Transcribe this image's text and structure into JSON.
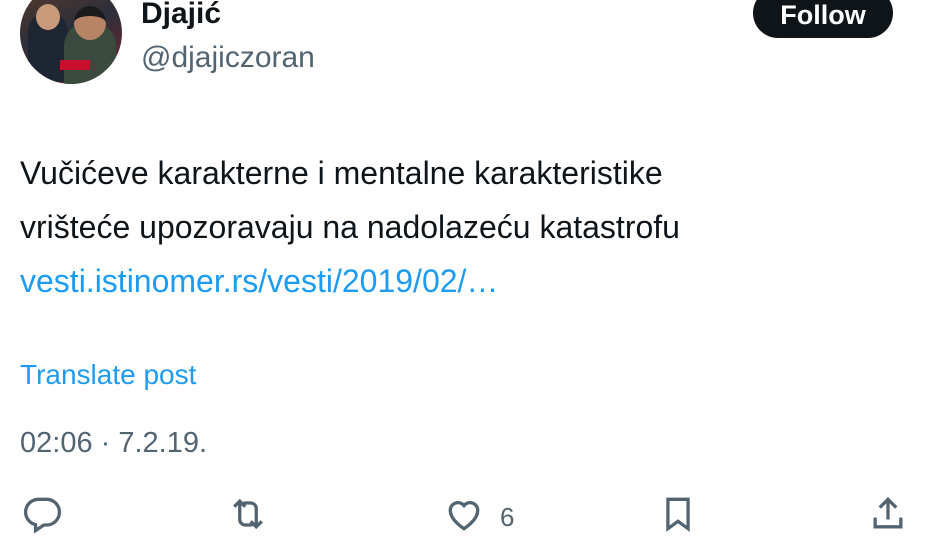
{
  "author": {
    "name": "Djajić",
    "handle": "@djajiczoran"
  },
  "follow_label": "Follow",
  "tweet": {
    "line1": "Vučićeve karakterne i mentalne karakteristike",
    "line2": "vrišteće upozoravaju na nadolazeću katastrofu",
    "link": "vesti.istinomer.rs/vesti/2019/02/…"
  },
  "translate_label": "Translate post",
  "timestamp": "02:06 · 7.2.19.",
  "actions": {
    "like_count": "6"
  },
  "colors": {
    "link": "#1d9bf0",
    "secondary_text": "#536471",
    "button_bg": "#0f1419"
  },
  "icons": [
    "reply-icon",
    "repost-icon",
    "like-icon",
    "bookmark-icon",
    "share-icon"
  ]
}
